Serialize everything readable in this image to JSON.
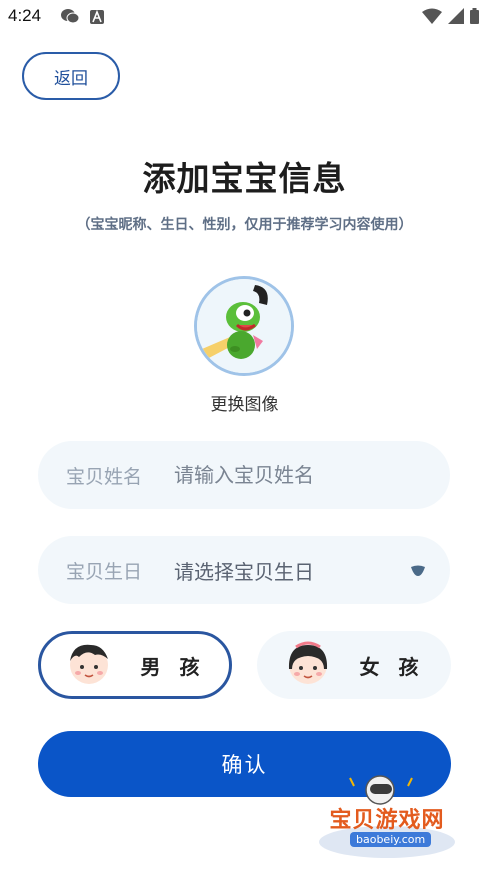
{
  "status_bar": {
    "time": "4:24",
    "icons": [
      "wechat-icon",
      "a-icon",
      "wifi-icon",
      "signal-icon",
      "battery-icon"
    ]
  },
  "header": {
    "back_label": "返回"
  },
  "title": "添加宝宝信息",
  "subtitle": "（宝宝昵称、生日、性别，仅用于推荐学习内容使用）",
  "avatar": {
    "change_label": "更换图像"
  },
  "form": {
    "name": {
      "label": "宝贝姓名",
      "placeholder": "请输入宝贝姓名",
      "value": ""
    },
    "birthday": {
      "label": "宝贝生日",
      "value": "请选择宝贝生日"
    }
  },
  "gender": {
    "selected": "男孩",
    "boy_label": "男 孩",
    "girl_label": "女 孩"
  },
  "confirm_label": "确认",
  "watermark": {
    "name": "宝贝游戏网",
    "url": "baobeiy.com"
  },
  "colors": {
    "accent": "#0a55c8",
    "border": "#2a56a0",
    "field_bg": "#f2f7fb"
  }
}
